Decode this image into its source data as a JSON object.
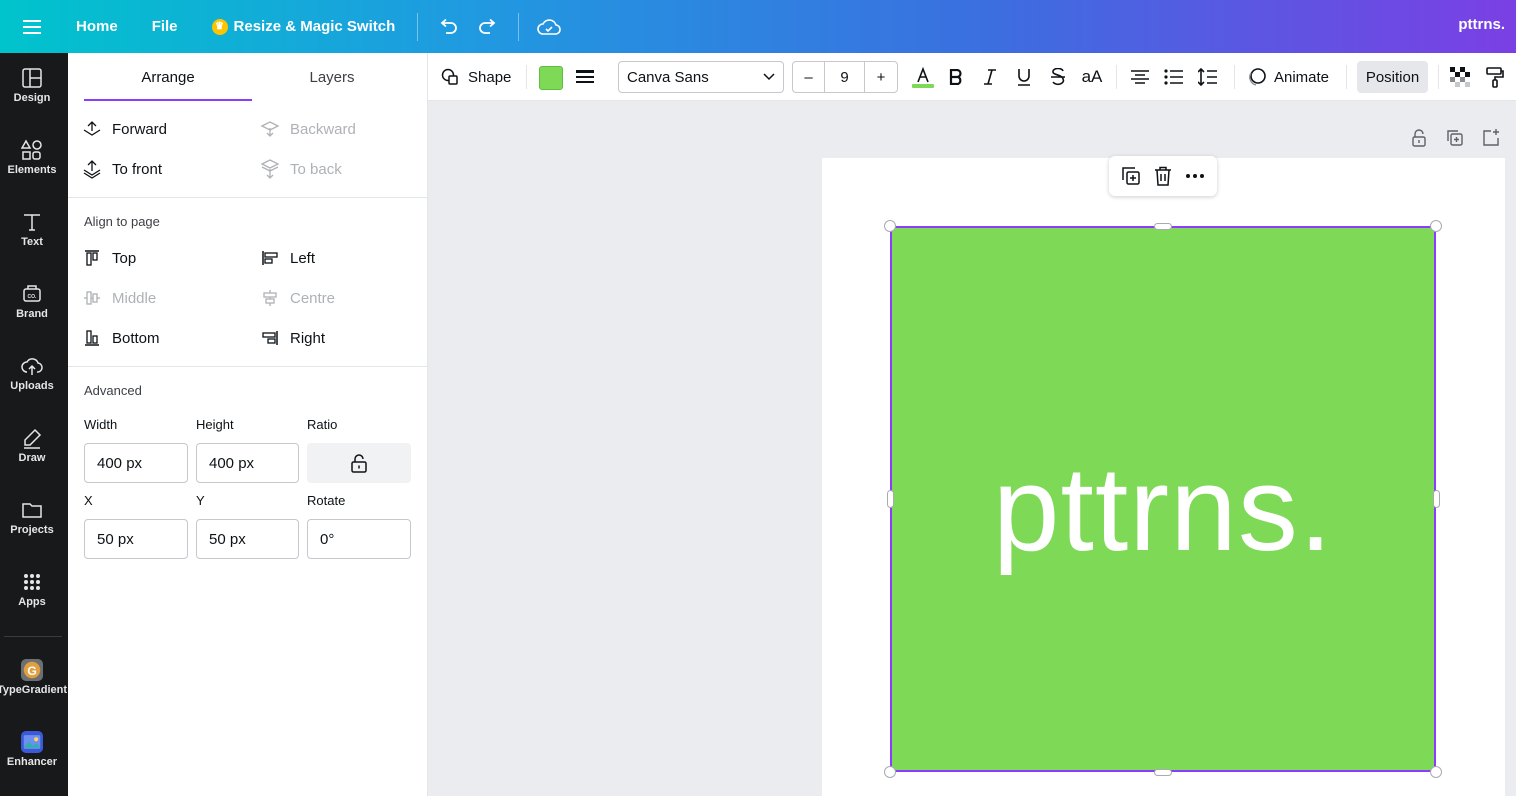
{
  "topbar": {
    "home_label": "Home",
    "file_label": "File",
    "resize_label": "Resize & Magic Switch",
    "brand_name": "pttrns."
  },
  "rail": {
    "items": [
      {
        "label": "Design",
        "icon": "layout-icon"
      },
      {
        "label": "Elements",
        "icon": "shapes-icon"
      },
      {
        "label": "Text",
        "icon": "text-icon"
      },
      {
        "label": "Brand",
        "icon": "brand-icon"
      },
      {
        "label": "Uploads",
        "icon": "cloud-upload-icon"
      },
      {
        "label": "Draw",
        "icon": "pen-icon"
      },
      {
        "label": "Projects",
        "icon": "folder-icon"
      },
      {
        "label": "Apps",
        "icon": "grid-icon"
      }
    ],
    "apps": [
      {
        "label": "TypeGradient",
        "icon": "typegradient-app-icon"
      },
      {
        "label": "Enhancer",
        "icon": "enhancer-app-icon"
      }
    ]
  },
  "panel": {
    "tabs": [
      "Arrange",
      "Layers"
    ],
    "layer_buttons": {
      "forward": "Forward",
      "backward": "Backward",
      "to_front": "To front",
      "to_back": "To back"
    },
    "align_title": "Align to page",
    "align": {
      "top": "Top",
      "left": "Left",
      "middle": "Middle",
      "centre": "Centre",
      "bottom": "Bottom",
      "right": "Right"
    },
    "advanced_title": "Advanced",
    "labels": {
      "width": "Width",
      "height": "Height",
      "ratio": "Ratio",
      "x": "X",
      "y": "Y",
      "rotate": "Rotate"
    },
    "values": {
      "width": "400 px",
      "height": "400 px",
      "x": "50 px",
      "y": "50 px",
      "rotate": "0°"
    }
  },
  "toolbar": {
    "shape_label": "Shape",
    "fill_color": "#7ed957",
    "font_name": "Canva Sans",
    "font_size": "9",
    "minus": "–",
    "plus": "+",
    "case_label": "aA",
    "animate_label": "Animate",
    "position_label": "Position"
  },
  "canvas": {
    "square_color": "#7ed957",
    "square_text": "pttrns."
  },
  "colors": {
    "accent": "#8b3dff",
    "rail_bg": "#18191b"
  }
}
